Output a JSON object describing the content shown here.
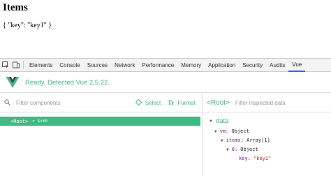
{
  "page": {
    "heading": "Items",
    "json_text": "{ \"key\": \"key1\" }"
  },
  "devtools": {
    "tabs": [
      {
        "label": "Elements"
      },
      {
        "label": "Console"
      },
      {
        "label": "Sources"
      },
      {
        "label": "Network"
      },
      {
        "label": "Performance"
      },
      {
        "label": "Memory"
      },
      {
        "label": "Application"
      },
      {
        "label": "Security"
      },
      {
        "label": "Audits"
      },
      {
        "label": "Vue",
        "active": true
      }
    ],
    "accent_color": "#1a73e8"
  },
  "vue": {
    "status": "Ready. Detected Vue 2.5.22.",
    "brand_color": "#42b983",
    "components": {
      "filter_placeholder": "Filter components",
      "select_label": "Select",
      "format_label": "Format",
      "tree_root": "<Root>",
      "tree_root_vm": "= $vm0"
    },
    "inspector": {
      "title": "<Root>",
      "filter_placeholder": "Filter inspected data",
      "section": "data",
      "vm_key": "vm:",
      "vm_type": "Object",
      "items_key": "items:",
      "items_type": "Array[1]",
      "index_key": "0:",
      "index_type": "Object",
      "key_key": "key:",
      "key_value": "\"key1\""
    }
  }
}
